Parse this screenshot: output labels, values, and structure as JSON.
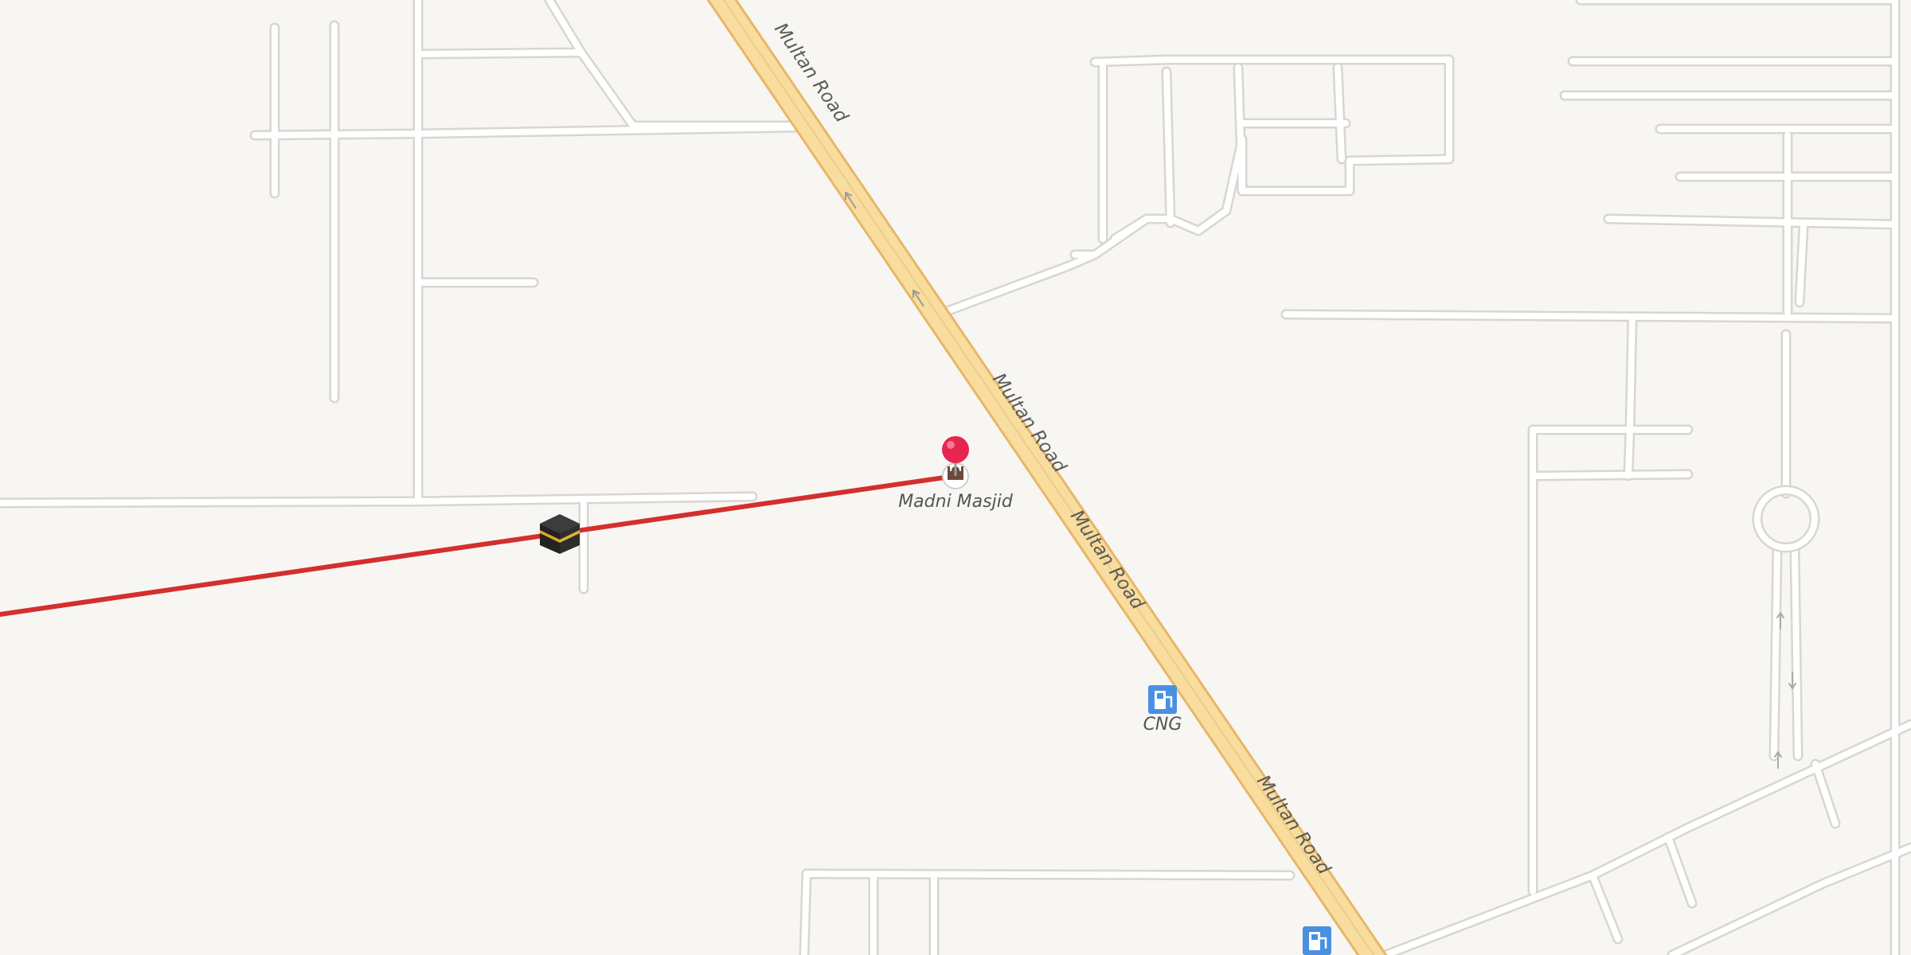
{
  "map": {
    "background": "#f8f6f2",
    "road_colors": {
      "minor_casing": "#d9d6d1",
      "minor_fill": "#ffffff",
      "highway_casing": "#e7b768",
      "highway_fill": "#f8dd9e"
    },
    "road_labels": [
      {
        "text": "Multan Road"
      },
      {
        "text": "Multan Road"
      },
      {
        "text": "Multan Road"
      },
      {
        "text": "Multan Road"
      }
    ],
    "qibla_line": {
      "color": "#d32f2f",
      "kaaba_icon": "kaaba-icon"
    },
    "pins": [
      {
        "name": "location-pin",
        "color": "#e8254f",
        "icon": "map-pin-icon"
      }
    ],
    "pois": [
      {
        "label": "Madni Masjid",
        "icon": "mosque-icon"
      },
      {
        "label": "CNG",
        "icon": "fuel-station-icon",
        "color": "#4a90e2"
      },
      {
        "label": "",
        "icon": "fuel-station-icon",
        "color": "#4a90e2"
      }
    ]
  }
}
